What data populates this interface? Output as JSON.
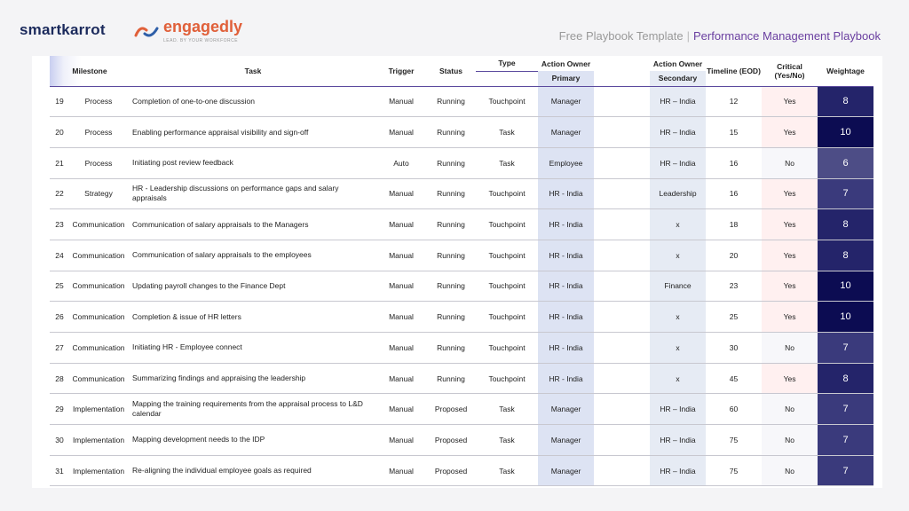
{
  "brand": {
    "smartkarrot": "smartkarrot",
    "engagedly": "engagedly",
    "engagedly_tagline": "LEAD. BY YOUR WORKFORCE"
  },
  "title": {
    "prefix": "Free Playbook Template",
    "separator": "|",
    "main": "Performance Management Playbook"
  },
  "colors": {
    "accent": "#6a3fa0",
    "header_rule": "#5b4a9e",
    "weight_dark": "#0c0c52"
  },
  "headers": {
    "milestone": "Milestone",
    "task": "Task",
    "trigger": "Trigger",
    "status": "Status",
    "type": "Type",
    "action_owner": "Action Owner",
    "primary": "Primary",
    "secondary": "Secondary",
    "timeline": "Timeline (EOD)",
    "critical": "Critical (Yes/No)",
    "weightage": "Weightage"
  },
  "rows": [
    {
      "num": "19",
      "milestone": "Process",
      "task": "Completion of one-to-one discussion",
      "trigger": "Manual",
      "status": "Running",
      "type": "Touchpoint",
      "primary": "Manager",
      "secondary": "HR – India",
      "timeline": "12",
      "critical": "Yes",
      "weightage": "8"
    },
    {
      "num": "20",
      "milestone": "Process",
      "task": "Enabling performance appraisal visibility and sign-off",
      "trigger": "Manual",
      "status": "Running",
      "type": "Task",
      "primary": "Manager",
      "secondary": "HR – India",
      "timeline": "15",
      "critical": "Yes",
      "weightage": "10"
    },
    {
      "num": "21",
      "milestone": "Process",
      "task": "Initiating post review feedback",
      "trigger": "Auto",
      "status": "Running",
      "type": "Task",
      "primary": "Employee",
      "secondary": "HR – India",
      "timeline": "16",
      "critical": "No",
      "weightage": "6"
    },
    {
      "num": "22",
      "milestone": "Strategy",
      "task": "HR - Leadership discussions on performance gaps and salary appraisals",
      "trigger": "Manual",
      "status": "Running",
      "type": "Touchpoint",
      "primary": "HR - India",
      "secondary": "Leadership",
      "timeline": "16",
      "critical": "Yes",
      "weightage": "7"
    },
    {
      "num": "23",
      "milestone": "Communication",
      "task": "Communication of salary appraisals to the Managers",
      "trigger": "Manual",
      "status": "Running",
      "type": "Touchpoint",
      "primary": "HR - India",
      "secondary": "x",
      "timeline": "18",
      "critical": "Yes",
      "weightage": "8"
    },
    {
      "num": "24",
      "milestone": "Communication",
      "task": "Communication of salary appraisals to the employees",
      "trigger": "Manual",
      "status": "Running",
      "type": "Touchpoint",
      "primary": "HR - India",
      "secondary": "x",
      "timeline": "20",
      "critical": "Yes",
      "weightage": "8"
    },
    {
      "num": "25",
      "milestone": "Communication",
      "task": "Updating payroll changes to the Finance Dept",
      "trigger": "Manual",
      "status": "Running",
      "type": "Touchpoint",
      "primary": "HR - India",
      "secondary": "Finance",
      "timeline": "23",
      "critical": "Yes",
      "weightage": "10"
    },
    {
      "num": "26",
      "milestone": "Communication",
      "task": "Completion & issue of HR letters",
      "trigger": "Manual",
      "status": "Running",
      "type": "Touchpoint",
      "primary": "HR - India",
      "secondary": "x",
      "timeline": "25",
      "critical": "Yes",
      "weightage": "10"
    },
    {
      "num": "27",
      "milestone": "Communication",
      "task": "Initiating HR - Employee connect",
      "trigger": "Manual",
      "status": "Running",
      "type": "Touchpoint",
      "primary": "HR - India",
      "secondary": "x",
      "timeline": "30",
      "critical": "No",
      "weightage": "7"
    },
    {
      "num": "28",
      "milestone": "Communication",
      "task": "Summarizing findings and appraising the leadership",
      "trigger": "Manual",
      "status": "Running",
      "type": "Touchpoint",
      "primary": "HR - India",
      "secondary": "x",
      "timeline": "45",
      "critical": "Yes",
      "weightage": "8"
    },
    {
      "num": "29",
      "milestone": "Implementation",
      "task": "Mapping the training requirements from the appraisal process to L&D calendar",
      "trigger": "Manual",
      "status": "Proposed",
      "type": "Task",
      "primary": "Manager",
      "secondary": "HR – India",
      "timeline": "60",
      "critical": "No",
      "weightage": "7"
    },
    {
      "num": "30",
      "milestone": "Implementation",
      "task": "Mapping development needs to the IDP",
      "trigger": "Manual",
      "status": "Proposed",
      "type": "Task",
      "primary": "Manager",
      "secondary": "HR – India",
      "timeline": "75",
      "critical": "No",
      "weightage": "7"
    },
    {
      "num": "31",
      "milestone": "Implementation",
      "task": "Re-aligning the individual employee goals as required",
      "trigger": "Manual",
      "status": "Proposed",
      "type": "Task",
      "primary": "Manager",
      "secondary": "HR – India",
      "timeline": "75",
      "critical": "No",
      "weightage": "7"
    }
  ]
}
